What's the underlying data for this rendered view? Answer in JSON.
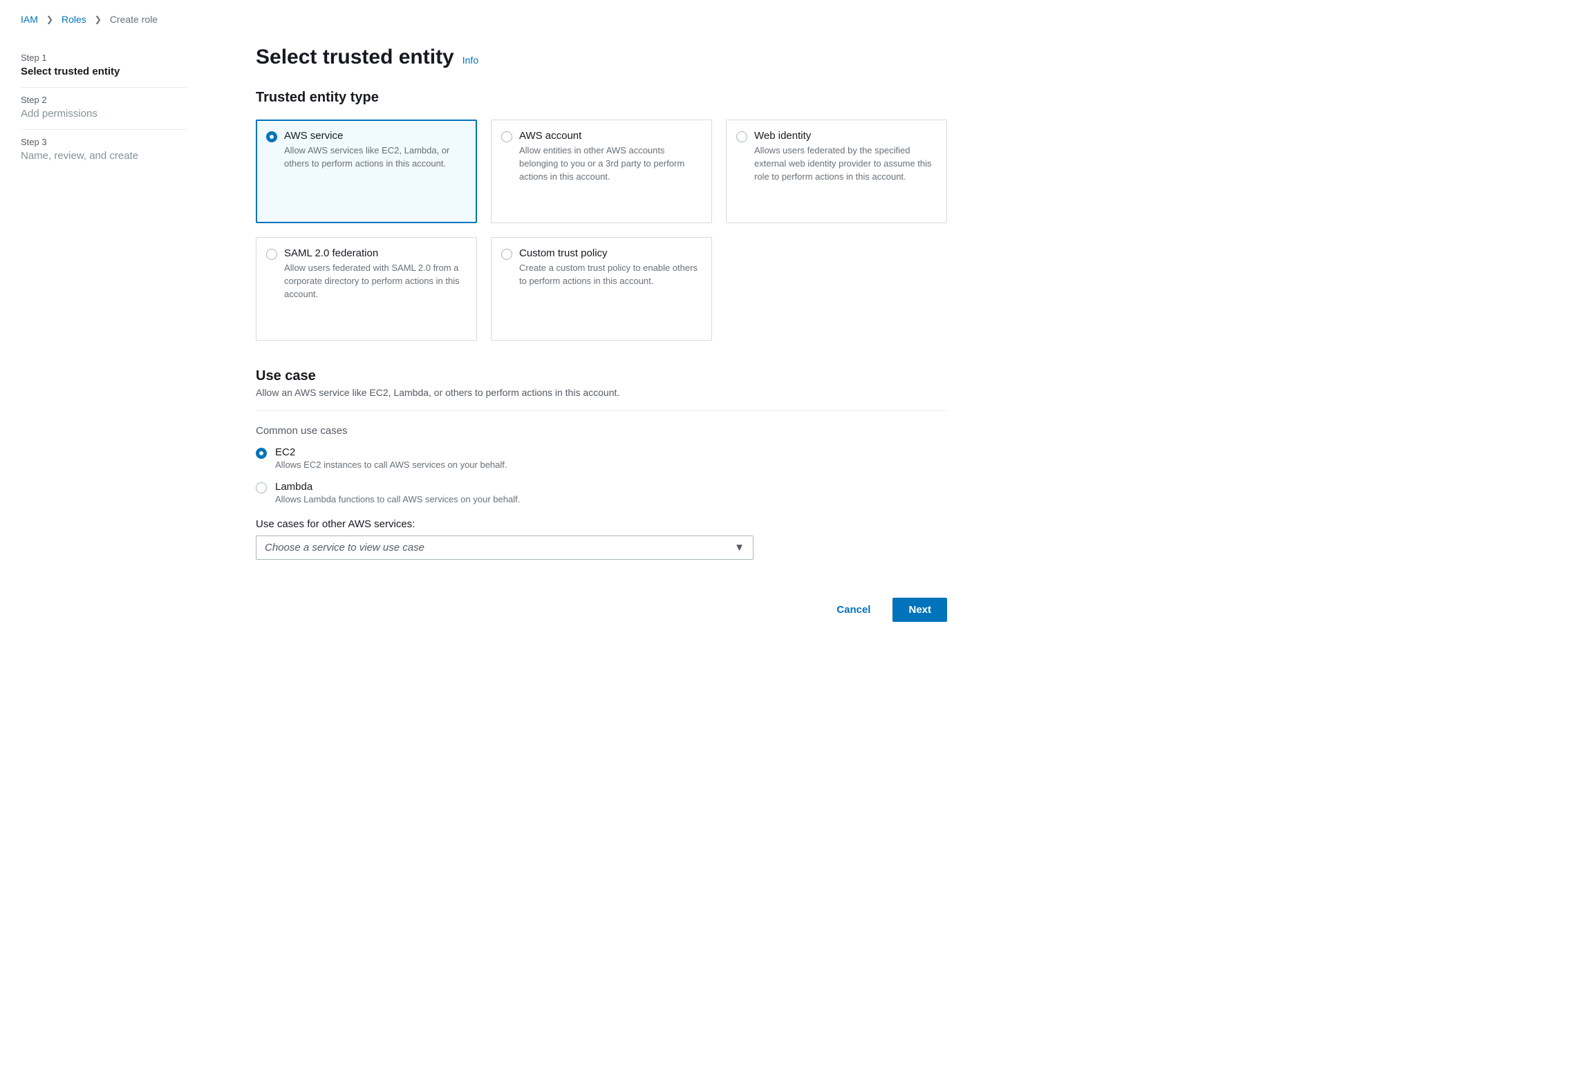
{
  "breadcrumb": {
    "items": [
      {
        "label": "IAM",
        "link": true
      },
      {
        "label": "Roles",
        "link": true
      },
      {
        "label": "Create role",
        "link": false
      }
    ]
  },
  "steps": [
    {
      "num": "Step 1",
      "title": "Select trusted entity",
      "active": true
    },
    {
      "num": "Step 2",
      "title": "Add permissions",
      "active": false
    },
    {
      "num": "Step 3",
      "title": "Name, review, and create",
      "active": false
    }
  ],
  "page": {
    "title": "Select trusted entity",
    "info_label": "Info"
  },
  "entity_section": {
    "title": "Trusted entity type",
    "options": [
      {
        "title": "AWS service",
        "desc": "Allow AWS services like EC2, Lambda, or others to perform actions in this account.",
        "selected": true
      },
      {
        "title": "AWS account",
        "desc": "Allow entities in other AWS accounts belonging to you or a 3rd party to perform actions in this account.",
        "selected": false
      },
      {
        "title": "Web identity",
        "desc": "Allows users federated by the specified external web identity provider to assume this role to perform actions in this account.",
        "selected": false
      },
      {
        "title": "SAML 2.0 federation",
        "desc": "Allow users federated with SAML 2.0 from a corporate directory to perform actions in this account.",
        "selected": false
      },
      {
        "title": "Custom trust policy",
        "desc": "Create a custom trust policy to enable others to perform actions in this account.",
        "selected": false
      }
    ]
  },
  "usecase_section": {
    "title": "Use case",
    "desc": "Allow an AWS service like EC2, Lambda, or others to perform actions in this account.",
    "common_label": "Common use cases",
    "common": [
      {
        "title": "EC2",
        "desc": "Allows EC2 instances to call AWS services on your behalf.",
        "selected": true
      },
      {
        "title": "Lambda",
        "desc": "Allows Lambda functions to call AWS services on your behalf.",
        "selected": false
      }
    ],
    "other_label": "Use cases for other AWS services:",
    "dropdown_placeholder": "Choose a service to view use case"
  },
  "footer": {
    "cancel": "Cancel",
    "next": "Next"
  }
}
